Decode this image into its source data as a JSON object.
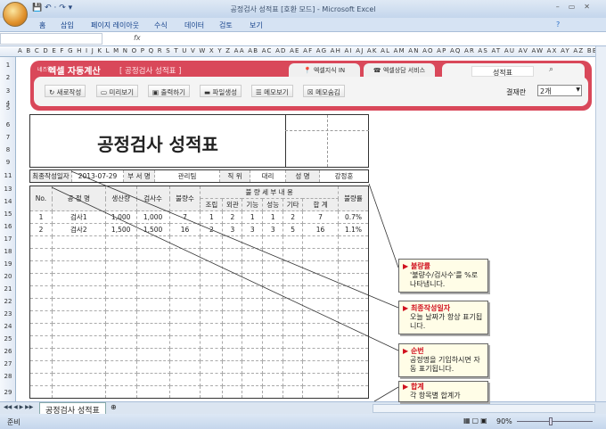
{
  "window": {
    "title": "공정검사 성적표 [호환 모드] - Microsoft Excel"
  },
  "ribbon_tabs": [
    "홈",
    "삽입",
    "페이지 레이아웃",
    "수식",
    "데이터",
    "검토",
    "보기"
  ],
  "formula_bar": {
    "fx": "fx",
    "value": ""
  },
  "columns": "A B C D E F G H I J K L M N O P Q R S T U V W X Y Z AA AB AC AD AE AF AG AH AI AJ AK AL AM AN AO AP AQ AR AS AT AU AV AW AX AY AZ BB BC",
  "rows": [
    "1",
    "2",
    "3",
    "4",
    "5",
    "6",
    "7",
    "8",
    "9",
    "11",
    "13",
    "14",
    "15",
    "16",
    "17",
    "18",
    "19",
    "20",
    "21",
    "22",
    "23",
    "24",
    "25",
    "26",
    "27",
    "28",
    "29"
  ],
  "banner": {
    "brand_small": "네즈웹",
    "brand": "엑셀 자동계산",
    "subtitle": "[ 공정검사 성적표 ]",
    "tab1": "엑셀지식 IN",
    "tab2": "엑셀상담 서비스",
    "search_value": "성적표",
    "buttons": [
      "새로작성",
      "미리보기",
      "출력하기",
      "파일생성",
      "메모보기",
      "메모숨김"
    ],
    "approval_label": "결재란",
    "approval_value": "2개"
  },
  "sheet": {
    "title": "공정검사 성적표",
    "info": {
      "date_label": "최종작성일자",
      "date": "2013-07-29",
      "dept_label": "부 서 명",
      "dept": "관리팀",
      "pos_label": "직   위",
      "pos": "대리",
      "name_label": "성   명",
      "name": "강정훈"
    },
    "headers": {
      "no": "No.",
      "process": "공  정  명",
      "production": "생산량",
      "inspection": "검사수",
      "defects": "불량수",
      "detail": "불 량 세 부 내 용",
      "assembly": "조립",
      "appearance": "외관",
      "function": "기능",
      "performance": "성능",
      "other": "기타",
      "total": "합  계",
      "rate": "불량률"
    },
    "rows": [
      [
        "1",
        "검사1",
        "1,000",
        "1,000",
        "7",
        "1",
        "2",
        "1",
        "1",
        "2",
        "7",
        "0.7%"
      ],
      [
        "2",
        "검사2",
        "1,500",
        "1,500",
        "16",
        "2",
        "3",
        "3",
        "3",
        "5",
        "16",
        "1.1%"
      ]
    ]
  },
  "callouts": [
    {
      "title": "불량률",
      "text": "'불량수/검사수'를 %로 나타냅니다."
    },
    {
      "title": "최종작성일자",
      "text": "오늘 날짜가 항상 표기됩니다."
    },
    {
      "title": "순번",
      "text": "공정명을 기입하시면 자동 표기됩니다."
    },
    {
      "title": "합계",
      "text": "각 항목별 합계가"
    }
  ],
  "sheet_tab": "공정검사 성적표",
  "status": {
    "text": "준비",
    "zoom": "90%"
  }
}
